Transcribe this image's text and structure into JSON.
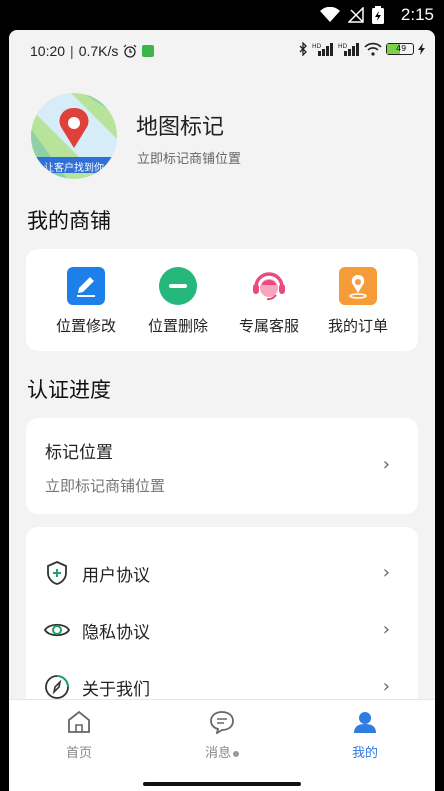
{
  "system": {
    "time": "2:15"
  },
  "inner_status": {
    "time": "10:20",
    "net_speed": "0.7K/s",
    "battery": "49"
  },
  "app": {
    "name": "地图标记",
    "subtitle": "立即标记商铺位置",
    "logo_caption": "让客户找到你"
  },
  "shop_section": {
    "title": "我的商铺",
    "items": [
      {
        "label": "位置修改",
        "icon": "edit-icon",
        "color": "#1d7fe8"
      },
      {
        "label": "位置删除",
        "icon": "minus-circle-icon",
        "color": "#25b77c"
      },
      {
        "label": "专属客服",
        "icon": "customer-service-icon",
        "color": "#e84b7d"
      },
      {
        "label": "我的订单",
        "icon": "location-pin-icon",
        "color": "#f59b3a"
      }
    ]
  },
  "progress_section": {
    "title": "认证进度",
    "card": {
      "title": "标记位置",
      "subtitle": "立即标记商铺位置"
    }
  },
  "menu": [
    {
      "label": "用户协议",
      "icon": "shield-plus-icon"
    },
    {
      "label": "隐私协议",
      "icon": "eye-icon"
    },
    {
      "label": "关于我们",
      "icon": "compass-icon"
    }
  ],
  "tabs": [
    {
      "label": "首页",
      "icon": "home-icon",
      "active": false
    },
    {
      "label": "消息",
      "icon": "chat-icon",
      "active": false
    },
    {
      "label": "我的",
      "icon": "user-icon",
      "active": true
    }
  ],
  "colors": {
    "active_tab": "#2f7de1",
    "inactive_tab": "#888888"
  }
}
